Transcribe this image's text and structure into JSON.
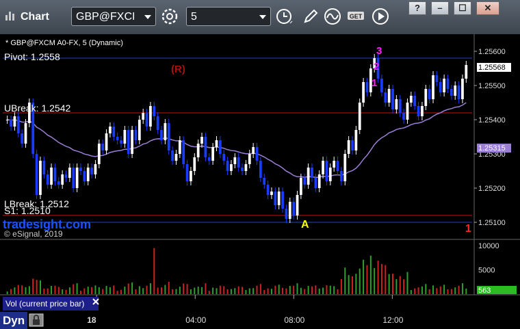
{
  "window": {
    "title": "Chart"
  },
  "toolbar": {
    "symbol": "GBP@FXCI",
    "interval": "5",
    "buttons": [
      "gear-icon",
      "clock-icon",
      "pencil-icon",
      "wave-icon",
      "get-icon",
      "play-icon"
    ]
  },
  "window_controls": [
    "?",
    "–",
    "☐",
    "✕"
  ],
  "colors": {
    "background": "#000000",
    "bull": "#ffffff",
    "bear": "#1a3cff",
    "ma": "#9b7fd4",
    "pivot": "#2244cc",
    "resistance": "#cc1111",
    "trail": "#00aa00",
    "accent_magenta": "#ff22ff",
    "tradesight": "#1a52ff",
    "price_label_bg": "#ffffff"
  },
  "chart_data": {
    "type": "candlestick",
    "title": "* GBP@FXCM A0-FX, 5 (Dynamic)",
    "y_range": [
      1.2505,
      1.2565
    ],
    "x_ticks": [
      {
        "label": "18",
        "pos": 0.2
      },
      {
        "label": "04:00",
        "pos": 0.41
      },
      {
        "label": "08:00",
        "pos": 0.62
      },
      {
        "label": "12:00",
        "pos": 0.83
      }
    ],
    "y_ticks": [
      "1.25600",
      "1.25500",
      "1.25400",
      "1.25300",
      "1.25200",
      "1.25100"
    ],
    "y_tick_values": [
      1.256,
      1.255,
      1.254,
      1.253,
      1.252,
      1.251
    ],
    "current_price": "1.25568",
    "current_price_value": 1.25568,
    "ma_value_label": "1.25315",
    "ma_value": 1.25315,
    "levels": [
      {
        "name": "Pivot",
        "label": "Pivot: 1.2558",
        "value": 1.2558,
        "color": "#2244cc"
      },
      {
        "name": "UBreak",
        "label": "UBreak: 1.2542",
        "value": 1.2542,
        "color": "#cc1111"
      },
      {
        "name": "LBreak",
        "label": "LBreak: 1.2512",
        "value": 1.2512,
        "color": "#cc1111"
      },
      {
        "name": "S1",
        "label": "S1: 1.2510",
        "value": 1.251,
        "color": "#2244cc"
      }
    ],
    "candles_close": [
      1.254,
      1.2538,
      1.2541,
      1.2536,
      1.2533,
      1.2539,
      1.2545,
      1.253,
      1.2518,
      1.2528,
      1.2524,
      1.2521,
      1.2526,
      1.2522,
      1.2521,
      1.2524,
      1.2523,
      1.2526,
      1.252,
      1.2526,
      1.2525,
      1.2522,
      1.2526,
      1.2524,
      1.2527,
      1.2533,
      1.2531,
      1.2536,
      1.2538,
      1.2535,
      1.2534,
      1.2533,
      1.2537,
      1.253,
      1.2537,
      1.2534,
      1.254,
      1.2542,
      1.2538,
      1.2544,
      1.2541,
      1.2537,
      1.2534,
      1.2539,
      1.2531,
      1.2528,
      1.253,
      1.2534,
      1.2527,
      1.2522,
      1.2525,
      1.2529,
      1.2533,
      1.2535,
      1.2529,
      1.2528,
      1.2532,
      1.2534,
      1.253,
      1.2528,
      1.2525,
      1.2527,
      1.2529,
      1.2526,
      1.2525,
      1.2527,
      1.253,
      1.2532,
      1.2528,
      1.2523,
      1.2521,
      1.2518,
      1.2519,
      1.2515,
      1.2519,
      1.2514,
      1.2511,
      1.2516,
      1.2512,
      1.2518,
      1.2523,
      1.2521,
      1.2526,
      1.2523,
      1.252,
      1.2524,
      1.2528,
      1.2522,
      1.2526,
      1.2528,
      1.2525,
      1.2522,
      1.253,
      1.2534,
      1.2531,
      1.2537,
      1.2545,
      1.2551,
      1.2548,
      1.2555,
      1.2558,
      1.2552,
      1.2548,
      1.2545,
      1.2549,
      1.2543,
      1.2546,
      1.2542,
      1.254,
      1.2545,
      1.2547,
      1.2544,
      1.2541,
      1.2544,
      1.2549,
      1.2546,
      1.2553,
      1.2551,
      1.2548,
      1.2552,
      1.2549,
      1.2547,
      1.255,
      1.2546,
      1.2552,
      1.2556
    ],
    "volume_ticks": [
      "10000",
      "5000"
    ],
    "volume_tick_values": [
      10000,
      5000
    ],
    "volume_max": 11000,
    "current_volume": "563",
    "annotations": [
      {
        "text": "(R)",
        "color": "#aa1111"
      },
      {
        "text": "A",
        "color": "#ffff00"
      },
      {
        "text": "1",
        "color": "#ff2222"
      },
      {
        "text": "3",
        "color": "#ff22ff"
      },
      {
        "text": "2",
        "color": "#ff22ff"
      },
      {
        "text": "1",
        "color": "#ff22ff"
      }
    ]
  },
  "brand": {
    "name": "tradesight.com",
    "copyright": "© eSignal, 2019"
  },
  "volume_panel": {
    "label": "Vol (current price bar)"
  },
  "status": {
    "mode": "Dyn"
  }
}
